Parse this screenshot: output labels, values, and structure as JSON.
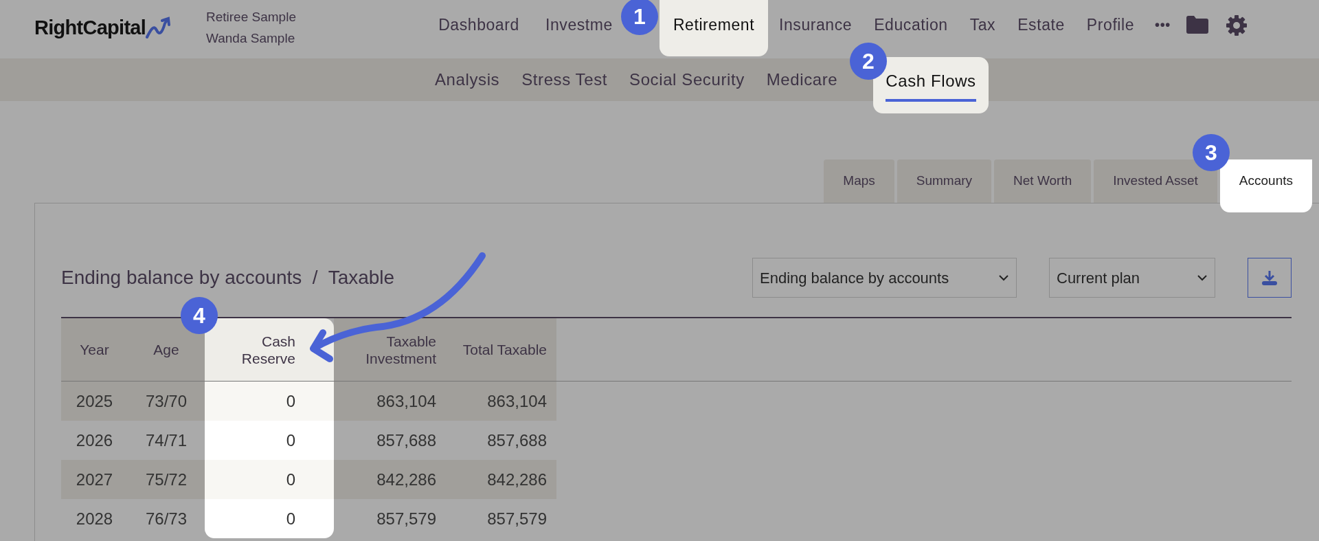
{
  "header": {
    "logo": "RightCapital",
    "clients": [
      "Retiree Sample",
      "Wanda Sample"
    ],
    "nav": [
      {
        "label": "Dashboard",
        "selected": false
      },
      {
        "label": "Investme",
        "selected": false
      },
      {
        "label": "Retirement",
        "selected": true
      },
      {
        "label": "Insurance",
        "selected": false
      },
      {
        "label": "Education",
        "selected": false
      },
      {
        "label": "Tax",
        "selected": false
      },
      {
        "label": "Estate",
        "selected": false
      },
      {
        "label": "Profile",
        "selected": false
      }
    ],
    "more": "•••"
  },
  "subnav": [
    {
      "label": "Analysis",
      "selected": false
    },
    {
      "label": "Stress Test",
      "selected": false
    },
    {
      "label": "Social Security",
      "selected": false
    },
    {
      "label": "Medicare",
      "selected": false
    },
    {
      "label": "Cash Flows",
      "selected": true
    }
  ],
  "view_tabs": [
    {
      "label": "Maps",
      "selected": false
    },
    {
      "label": "Summary",
      "selected": false
    },
    {
      "label": "Net Worth",
      "selected": false
    },
    {
      "label": "Invested Asset",
      "selected": false
    },
    {
      "label": "Accounts",
      "selected": true
    }
  ],
  "panel": {
    "title": "Ending balance by accounts  /  Taxable",
    "report_select": "Ending balance by accounts",
    "plan_select": "Current plan"
  },
  "table": {
    "columns": [
      {
        "label": "Year",
        "highlighted": false
      },
      {
        "label": "Age",
        "highlighted": false
      },
      {
        "label": "Cash Reserve",
        "highlighted": true
      },
      {
        "label": "Taxable Investment",
        "highlighted": false
      },
      {
        "label": "Total Taxable",
        "highlighted": false
      }
    ],
    "rows": [
      [
        "2025",
        "73/70",
        "0",
        "863,104",
        "863,104"
      ],
      [
        "2026",
        "74/71",
        "0",
        "857,688",
        "857,688"
      ],
      [
        "2027",
        "75/72",
        "0",
        "842,286",
        "842,286"
      ],
      [
        "2028",
        "76/73",
        "0",
        "857,579",
        "857,579"
      ]
    ]
  },
  "callouts": [
    "1",
    "2",
    "3",
    "4"
  ]
}
